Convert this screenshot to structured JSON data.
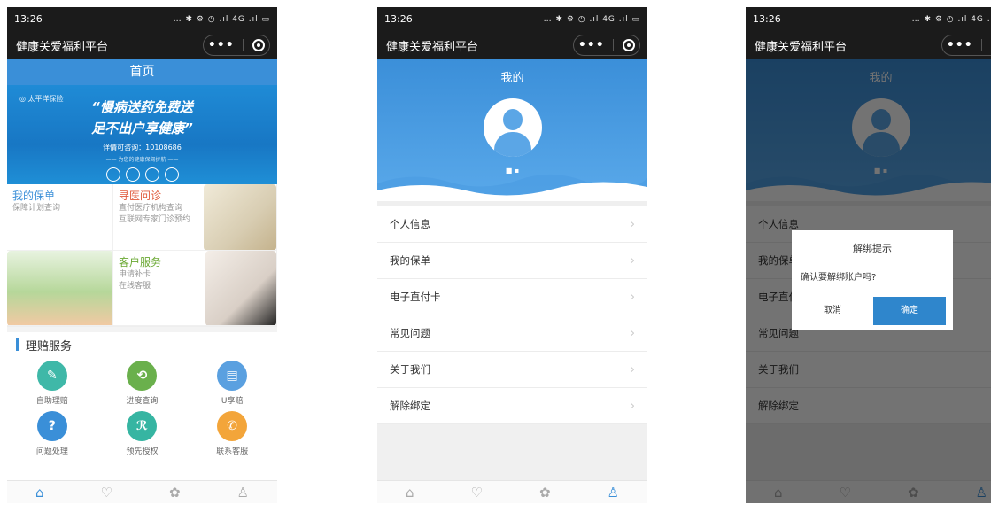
{
  "status": {
    "time": "13:26",
    "icons": "… ✱ ⚙ ◷ .ıl 4G .ıl ▭"
  },
  "app": {
    "title": "健康关爱福利平台",
    "more": "•••"
  },
  "home": {
    "title": "首页",
    "banner": {
      "logo": "◎ 太平洋保险",
      "line1": "“慢病送药免费送",
      "line2": "足不出户享健康”",
      "line3": "详情可咨询：10108686",
      "line4": "—— 为您的健康保驾护航 ——"
    },
    "tiles": [
      {
        "title": "我的保单",
        "sub": [
          "保障计划查询"
        ]
      },
      {
        "title": "寻医问诊",
        "sub": [
          "直付医疗机构查询",
          "互联网专家门诊预约"
        ]
      },
      {
        "title": "",
        "sub": []
      },
      {
        "title": "客户服务",
        "sub": [
          "申请补卡",
          "在线客服"
        ]
      }
    ],
    "section": "理赔服务",
    "services": [
      {
        "label": "自助理赔",
        "icon": "claim-doc-icon",
        "color": "#3fb8a8",
        "glyph": "✎"
      },
      {
        "label": "进度查询",
        "icon": "progress-search-icon",
        "color": "#6ab04c",
        "glyph": "⟲"
      },
      {
        "label": "U享赔",
        "icon": "u-claim-icon",
        "color": "#5aa0e0",
        "glyph": "▤"
      },
      {
        "label": "问题处理",
        "icon": "question-icon",
        "color": "#3a8fd8",
        "glyph": "?"
      },
      {
        "label": "预先授权",
        "icon": "authorize-user-icon",
        "color": "#36b5a2",
        "glyph": "ℛ"
      },
      {
        "label": "联系客服",
        "icon": "phone-icon",
        "color": "#f3a53a",
        "glyph": "✆"
      }
    ]
  },
  "tabbar": {
    "icons": [
      "⌂",
      "♡",
      "✿",
      "♙"
    ]
  },
  "mine": {
    "title": "我的",
    "items": [
      "个人信息",
      "我的保单",
      "电子直付卡",
      "常见问题",
      "关于我们",
      "解除绑定"
    ]
  },
  "dialog": {
    "title": "解绑提示",
    "message": "确认要解绑账户吗?",
    "cancel": "取消",
    "confirm": "确定"
  }
}
